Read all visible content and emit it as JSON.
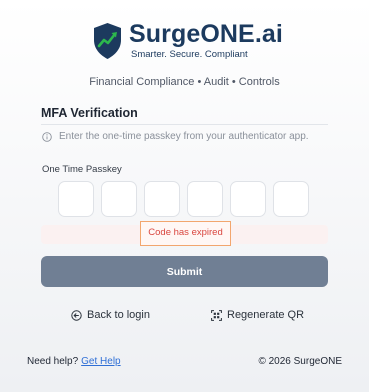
{
  "brand": {
    "name_main": "Surge",
    "name_accent": "ONE.ai",
    "tagline": "Smarter. Secure. Compliant",
    "logo_icon": "shield-chart-icon",
    "colors": {
      "navy": "#1c3a5e",
      "arrow": "#2db84d"
    }
  },
  "subtitle": "Financial Compliance • Audit • Controls",
  "mfa": {
    "title": "MFA Verification",
    "info_icon": "info-circle-icon",
    "info_text": "Enter the one-time passkey from your authenticator app.",
    "otp_label": "One Time Passkey",
    "otp_values": [
      "",
      "",
      "",
      "",
      "",
      ""
    ],
    "error_text": "Code has expired",
    "submit_label": "Submit"
  },
  "links": {
    "back_label": "Back to login",
    "back_icon": "circle-arrow-left-icon",
    "regenerate_label": "Regenerate QR",
    "regenerate_icon": "qr-scan-icon"
  },
  "footer": {
    "help_text": "Need help?",
    "help_link": "Get Help",
    "copyright": "© 2026 SurgeONE"
  },
  "colors": {
    "submit_bg": "#707f94",
    "error_text": "#d9463f",
    "error_border": "#f2a66e",
    "link": "#2f6fd6"
  }
}
